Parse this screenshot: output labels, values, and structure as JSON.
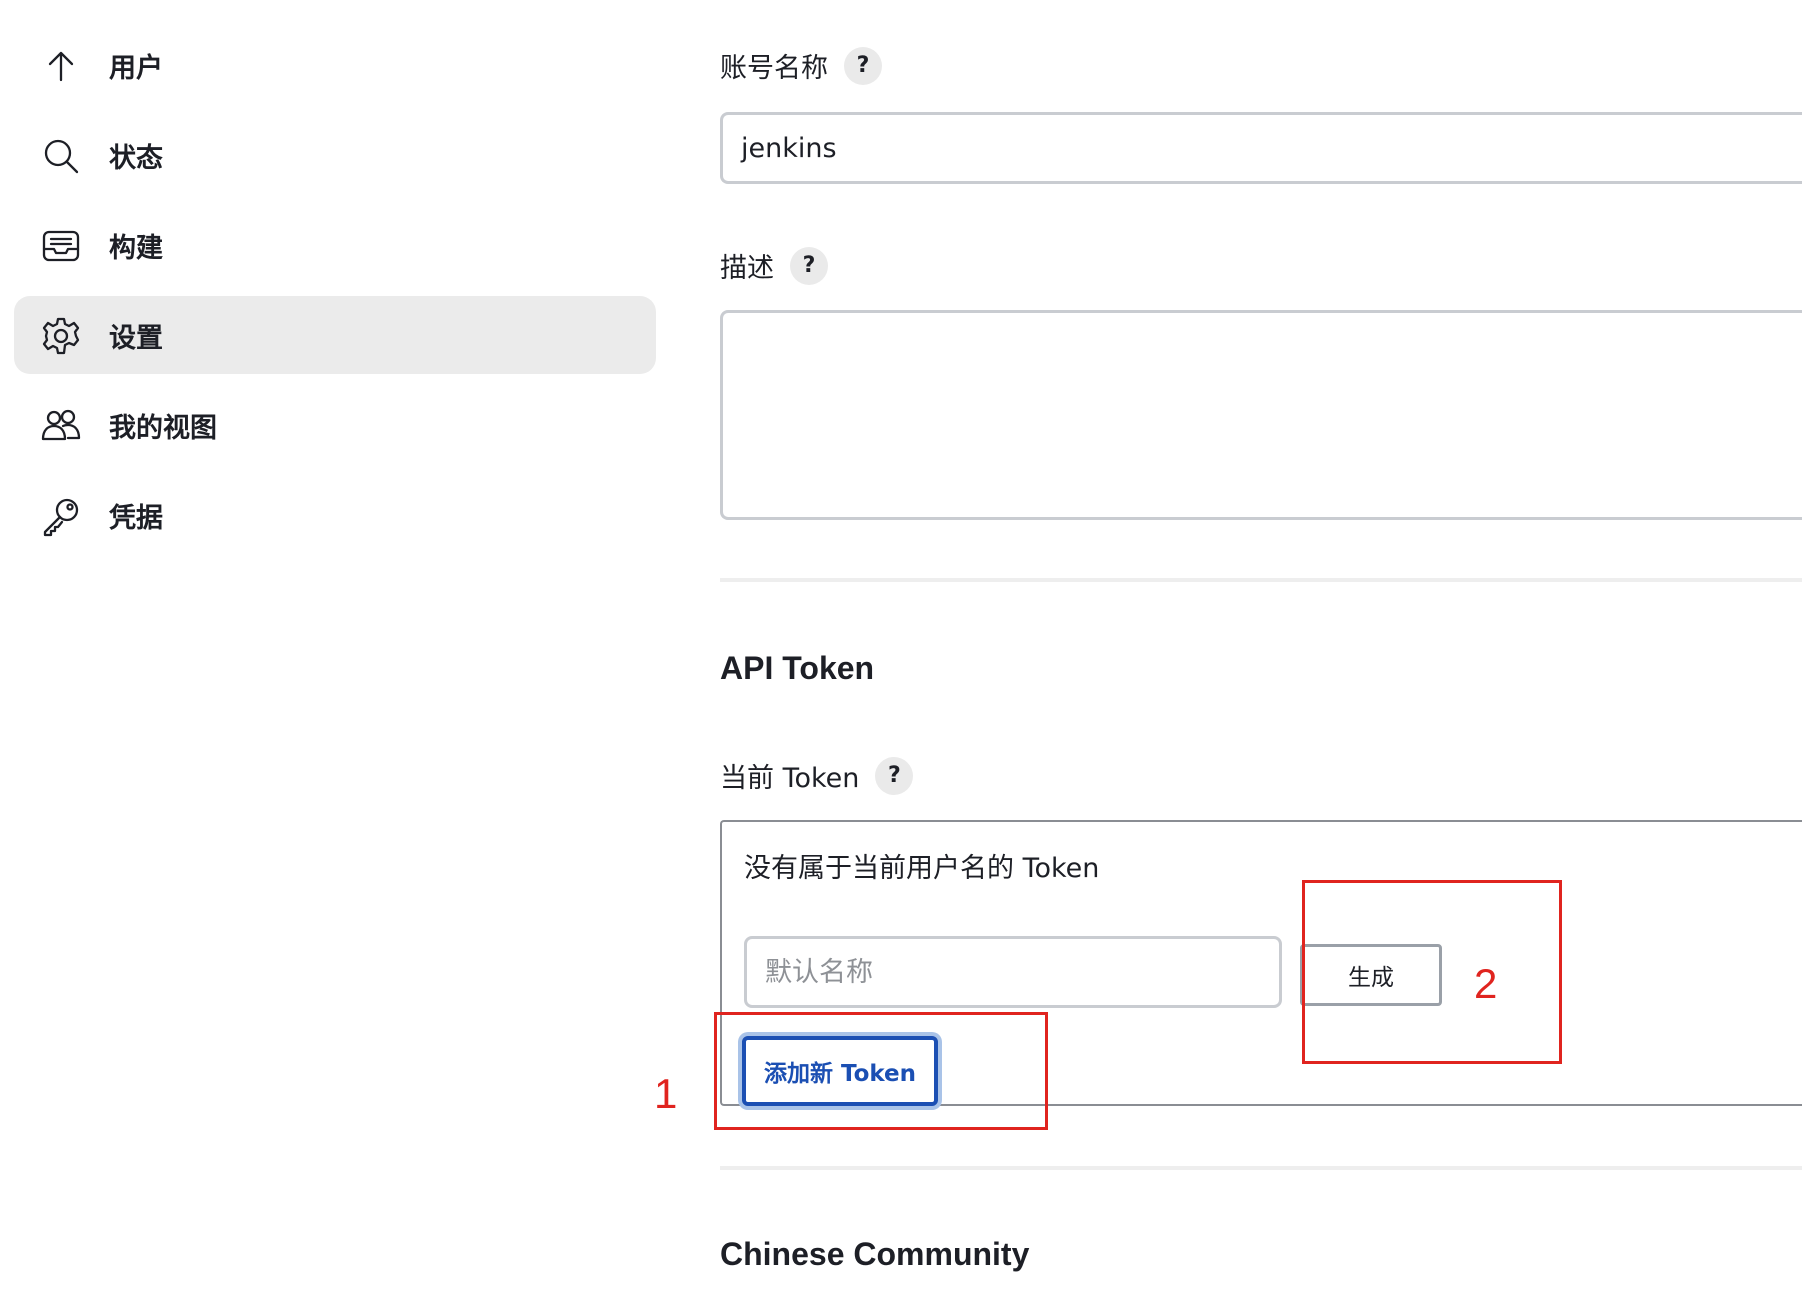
{
  "sidebar": {
    "items": [
      {
        "label": "用户",
        "icon": "arrow-up-icon",
        "active": false
      },
      {
        "label": "状态",
        "icon": "search-icon",
        "active": false
      },
      {
        "label": "构建",
        "icon": "inbox-icon",
        "active": false
      },
      {
        "label": "设置",
        "icon": "gear-icon",
        "active": true
      },
      {
        "label": "我的视图",
        "icon": "people-icon",
        "active": false
      },
      {
        "label": "凭据",
        "icon": "key-icon",
        "active": false
      }
    ]
  },
  "form": {
    "account_name": {
      "label": "账号名称",
      "help": "?",
      "value": "jenkins"
    },
    "description": {
      "label": "描述",
      "help": "?",
      "value": ""
    }
  },
  "api_token": {
    "section_title": "API Token",
    "current_label": "当前 Token",
    "help": "?",
    "empty_message": "没有属于当前用户名的 Token",
    "name_placeholder": "默认名称",
    "generate_label": "生成",
    "add_label": "添加新 Token"
  },
  "chinese_community": {
    "section_title": "Chinese Community"
  },
  "annotations": {
    "one": "1",
    "two": "2",
    "color": "#e0241f"
  },
  "colors": {
    "accent": "#1b4fb3",
    "active_nav_bg": "#ebebeb",
    "annotation": "#e0241f"
  }
}
